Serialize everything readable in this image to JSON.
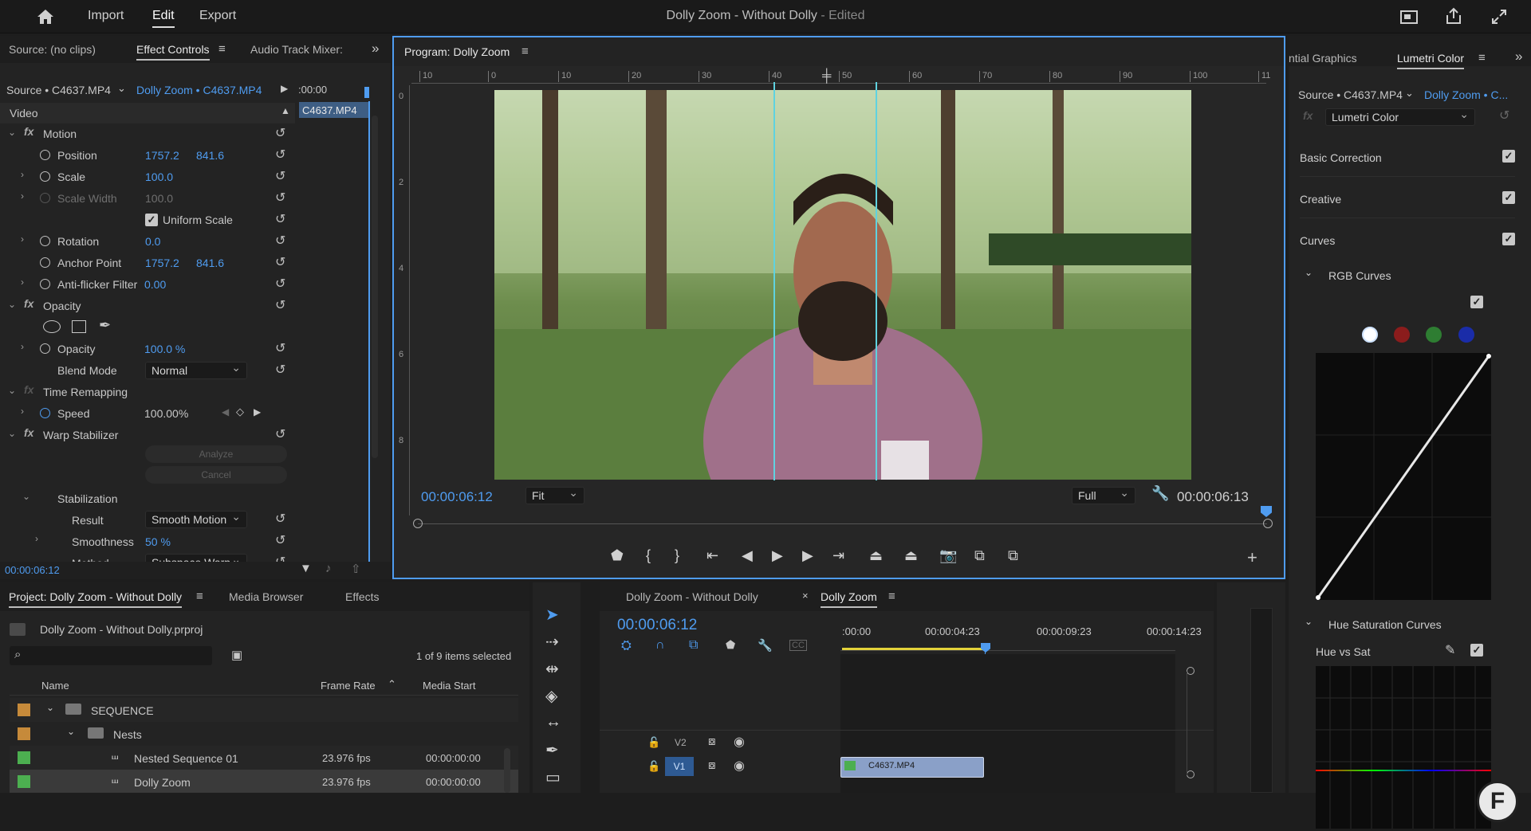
{
  "app": {
    "title": "Dolly Zoom - Without Dolly",
    "title_suffix": " - Edited",
    "menu": [
      "Import",
      "Edit",
      "Export"
    ]
  },
  "icons": {
    "home": "home-icon",
    "quick_export": "quick-export-icon",
    "share": "share-icon",
    "fullscreen": "fullscreen-icon"
  },
  "effect_panel": {
    "tabs": [
      "Source: (no clips)",
      "Effect Controls",
      "Audio Track Mixer:"
    ],
    "source_label": "Source • C4637.MP4",
    "sequence_label": "Dolly Zoom • C4637.MP4",
    "timecode_start": ":00:00",
    "clip_label": "C4637.MP4",
    "video_header": "Video",
    "motion": "Motion",
    "position": "Position",
    "position_x": "1757.2",
    "position_y": "841.6",
    "scale": "Scale",
    "scale_val": "100.0",
    "scale_width": "Scale Width",
    "scale_width_val": "100.0",
    "uniform_scale": "Uniform Scale",
    "rotation": "Rotation",
    "rotation_val": "0.0",
    "anchor": "Anchor Point",
    "anchor_x": "1757.2",
    "anchor_y": "841.6",
    "antiflicker": "Anti-flicker Filter",
    "antiflicker_val": "0.00",
    "opacity": "Opacity",
    "opacity_val": "100.0 %",
    "blend": "Blend Mode",
    "blend_val": "Normal",
    "time_remap": "Time Remapping",
    "speed": "Speed",
    "speed_val": "100.00%",
    "warp": "Warp Stabilizer",
    "analyze": "Analyze",
    "cancel": "Cancel",
    "stabilization": "Stabilization",
    "result": "Result",
    "result_val": "Smooth Motion",
    "smoothness": "Smoothness",
    "smoothness_val": "50 %",
    "method_partial": "Method",
    "method_val": "Subspace Warp",
    "timecode": "00:00:06:12"
  },
  "program": {
    "tab": "Program: Dolly Zoom",
    "ruler": [
      "10",
      "0",
      "10",
      "20",
      "30",
      "40",
      "50",
      "60",
      "70",
      "80",
      "90",
      "100",
      "11"
    ],
    "vruler": [
      "0",
      "2",
      "4",
      "6",
      "8"
    ],
    "timecode": "00:00:06:12",
    "fit": "Fit",
    "full": "Full",
    "duration": "00:00:06:13"
  },
  "lumetri": {
    "tabs": [
      "ntial Graphics",
      "Lumetri Color"
    ],
    "source_label": "Source • C4637.MP4",
    "sequence_label": "Dolly Zoom • C...",
    "effect": "Lumetri Color",
    "sections": [
      "Basic Correction",
      "Creative",
      "Curves"
    ],
    "rgb_curves": "RGB Curves",
    "hue_sat": "Hue Saturation Curves",
    "hue_vs_sat": "Hue vs Sat",
    "channel_colors": [
      "#ffffff",
      "#8b1c1c",
      "#2e7d32",
      "#1a2ca8"
    ]
  },
  "project": {
    "tabs": [
      "Project: Dolly Zoom - Without Dolly",
      "Media Browser",
      "Effects"
    ],
    "file": "Dolly Zoom - Without Dolly.prproj",
    "selected": "1 of 9 items selected",
    "columns": [
      "Name",
      "Frame Rate",
      "Media Start"
    ],
    "rows": [
      {
        "name": "SEQUENCE",
        "fps": "",
        "start": "",
        "color": "#c68a3a"
      },
      {
        "name": "Nests",
        "fps": "",
        "start": "",
        "color": "#c68a3a"
      },
      {
        "name": "Nested Sequence 01",
        "fps": "23.976 fps",
        "start": "00:00:00:00",
        "color": "#4caf50"
      },
      {
        "name": "Dolly Zoom",
        "fps": "23.976 fps",
        "start": "00:00:00:00",
        "color": "#4caf50"
      }
    ]
  },
  "timeline": {
    "tabs": [
      "Dolly Zoom - Without Dolly",
      "Dolly Zoom"
    ],
    "timecode": "00:00:06:12",
    "ruler": [
      ":00:00",
      "00:00:04:23",
      "00:00:09:23",
      "00:00:14:23"
    ],
    "tracks": [
      "V2",
      "V1"
    ],
    "clip": "C4637.MP4"
  }
}
